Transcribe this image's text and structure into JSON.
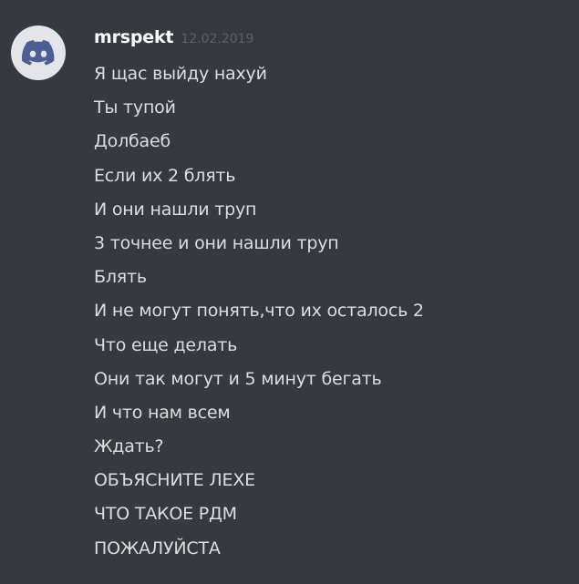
{
  "author": {
    "username": "mrspekt",
    "timestamp": "12.02.2019",
    "avatar_icon": "discord-logo-icon",
    "avatar_color": "#e3e5e8",
    "icon_color": "#4e5d94"
  },
  "colors": {
    "background": "#36393f",
    "username": "#ffffff",
    "message_text": "#dcddde",
    "timestamp": "#5c5f66"
  },
  "messages": [
    "Я щас выйду нахуй",
    "Ты тупой",
    "Долбаеб",
    "Если их 2 блять",
    "И они нашли труп",
    "3 точнее и они нашли труп",
    "Блять",
    "И не могут понять,что их осталось 2",
    "Что еще делать",
    "Они так могут и 5 минут бегать",
    "И что нам всем",
    "Ждать?",
    "ОБЪЯСНИТЕ ЛЕХЕ",
    "ЧТО ТАКОЕ РДМ",
    "ПОЖАЛУЙСТА"
  ]
}
